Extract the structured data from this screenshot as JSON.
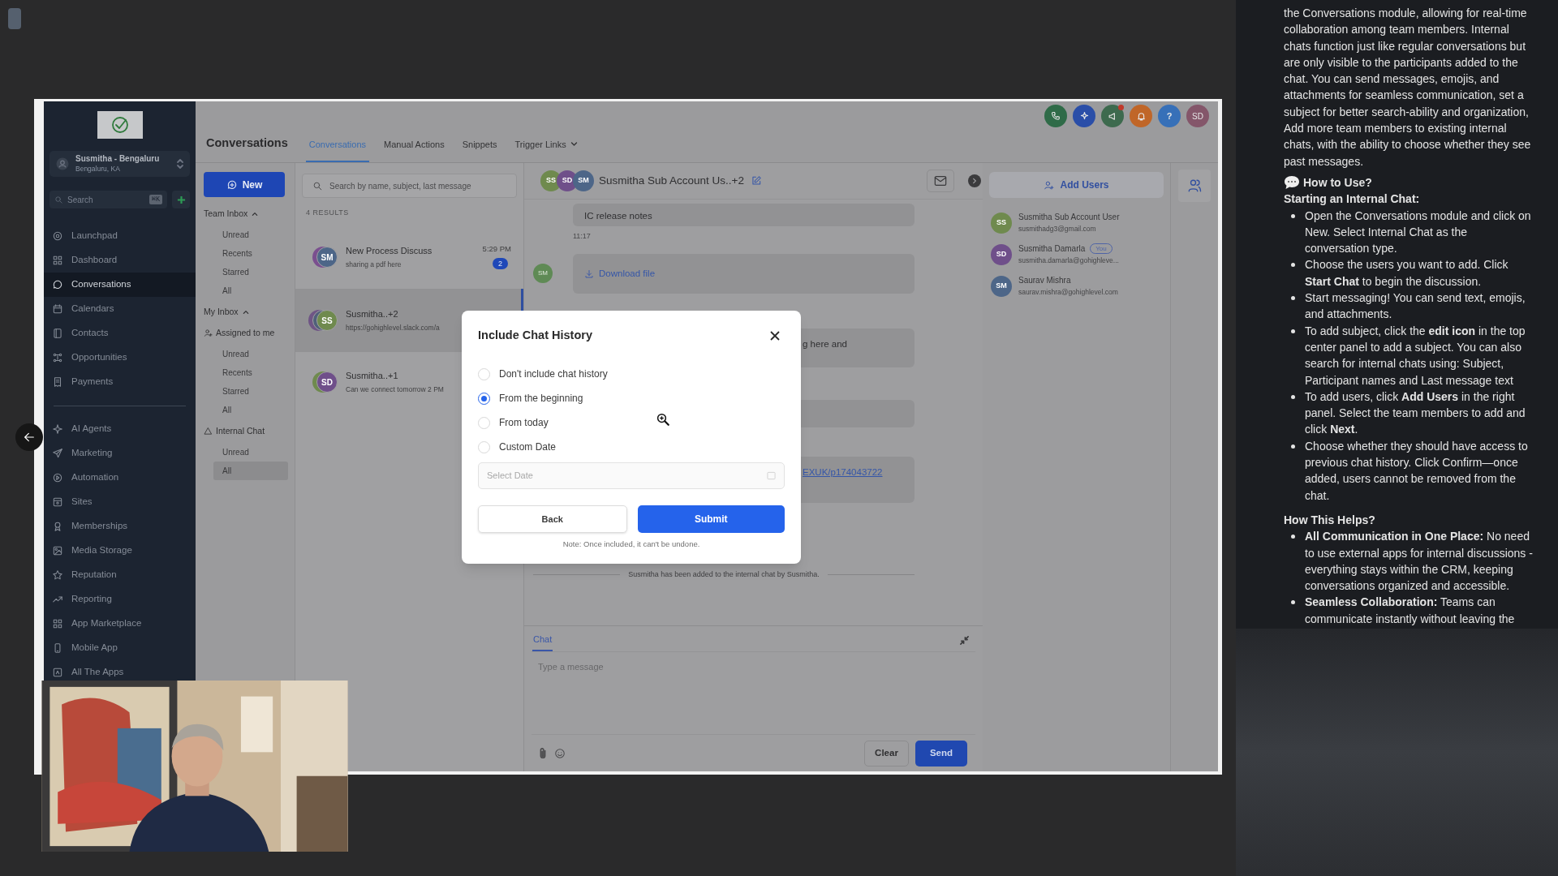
{
  "sidebar": {
    "account": {
      "name": "Susmitha - Bengaluru",
      "location": "Bengaluru, KA"
    },
    "search": {
      "placeholder": "Search",
      "shortcut": "⌘K"
    },
    "primary_items": [
      {
        "label": "Launchpad",
        "selected": false
      },
      {
        "label": "Dashboard",
        "selected": false
      },
      {
        "label": "Conversations",
        "selected": true
      },
      {
        "label": "Calendars",
        "selected": false
      },
      {
        "label": "Contacts",
        "selected": false
      },
      {
        "label": "Opportunities",
        "selected": false
      },
      {
        "label": "Payments",
        "selected": false
      }
    ],
    "secondary_items": [
      {
        "label": "AI Agents",
        "selected": false
      },
      {
        "label": "Marketing",
        "selected": false
      },
      {
        "label": "Automation",
        "selected": false
      },
      {
        "label": "Sites",
        "selected": false
      },
      {
        "label": "Memberships",
        "selected": false
      },
      {
        "label": "Media Storage",
        "selected": false
      },
      {
        "label": "Reputation",
        "selected": false
      },
      {
        "label": "Reporting",
        "selected": false
      },
      {
        "label": "App Marketplace",
        "selected": false
      },
      {
        "label": "Mobile App",
        "selected": false
      },
      {
        "label": "All The Apps",
        "selected": false
      }
    ]
  },
  "header": {
    "title": "Conversations",
    "tabs": [
      {
        "label": "Conversations",
        "selected": true
      },
      {
        "label": "Manual Actions",
        "selected": false
      },
      {
        "label": "Snippets",
        "selected": false
      },
      {
        "label": "Trigger Links",
        "selected": false,
        "dropdown": true
      }
    ],
    "help": "?",
    "user_initials": "SD"
  },
  "inbox_nav": {
    "new_button": "New",
    "sections": [
      {
        "label": "Team Inbox",
        "kind": "group",
        "expanded": true,
        "children": [
          {
            "label": "Unread",
            "selected": false
          },
          {
            "label": "Recents",
            "selected": false
          },
          {
            "label": "Starred",
            "selected": false
          },
          {
            "label": "All",
            "selected": false
          }
        ]
      },
      {
        "label": "My Inbox",
        "kind": "group",
        "expanded": true
      },
      {
        "label": "Assigned to me",
        "kind": "folder",
        "children": [
          {
            "label": "Unread",
            "selected": false
          },
          {
            "label": "Recents",
            "selected": false
          },
          {
            "label": "Starred",
            "selected": false
          },
          {
            "label": "All",
            "selected": false
          }
        ]
      },
      {
        "label": "Internal Chat",
        "kind": "folder",
        "children": [
          {
            "label": "Unread",
            "selected": false
          },
          {
            "label": "All",
            "selected": true
          }
        ]
      }
    ]
  },
  "conversation_list": {
    "search_placeholder": "Search by name, subject, last message",
    "result_count": "4 RESULTS",
    "items": [
      {
        "title": "New Process Discuss",
        "preview": "sharing a pdf here",
        "time": "5:29 PM",
        "unread": "2",
        "selected": false,
        "avatars": [
          {
            "color": "#7a4f8f"
          },
          {
            "initials": "SM",
            "color": "#4d6688"
          }
        ]
      },
      {
        "title": "Susmitha..+2",
        "preview": "https://gohighlevel.slack.com/a",
        "selected": true,
        "avatars": [
          {
            "color": "#6f5585"
          },
          {
            "color": "#50607a"
          },
          {
            "initials": "SS",
            "color": "#6f8a4e"
          }
        ]
      },
      {
        "title": "Susmitha..+1",
        "preview": "Can we connect tomorrow 2 PM",
        "selected": false,
        "avatars": [
          {
            "color": "#6f8a4e"
          },
          {
            "initials": "SD",
            "color": "#6f4f8a"
          }
        ]
      }
    ]
  },
  "chat": {
    "title": "Susmitha Sub Account Us..+2",
    "avatars": [
      {
        "initials": "SS",
        "color": "#6f8a4e"
      },
      {
        "initials": "SD",
        "color": "#6f4f8a"
      },
      {
        "initials": "SM",
        "color": "#4d6688"
      }
    ],
    "messages": [
      {
        "kind": "text",
        "text": "IC release notes",
        "time": "11:17"
      },
      {
        "kind": "file",
        "avatar": "SM",
        "text": "Download file"
      },
      {
        "kind": "text",
        "text": "g here and"
      },
      {
        "kind": "blank"
      },
      {
        "kind": "link",
        "text": "EXUK/p174043722"
      }
    ],
    "system_note": "Susmitha has been added to the internal chat by Susmitha.",
    "composer": {
      "tab": "Chat",
      "placeholder": "Type a message",
      "clear": "Clear",
      "send": "Send"
    }
  },
  "participants_panel": {
    "add_users": "Add Users",
    "users": [
      {
        "name": "Susmitha Sub Account User",
        "email": "susmithadg3@gmail.com",
        "initials": "SS",
        "color": "#6f8a4e"
      },
      {
        "name": "Susmitha Damarla",
        "email": "susmitha.damarla@gohighleve...",
        "initials": "SD",
        "color": "#6f4f8a",
        "badge": "You"
      },
      {
        "name": "Saurav Mishra",
        "email": "saurav.mishra@gohighlevel.com",
        "initials": "SM",
        "color": "#4d6688"
      }
    ]
  },
  "dialog": {
    "title": "Include Chat History",
    "options": [
      {
        "label": "Don't include chat history",
        "selected": false
      },
      {
        "label": "From the beginning",
        "selected": true
      },
      {
        "label": "From today",
        "selected": false
      },
      {
        "label": "Custom Date",
        "selected": false
      }
    ],
    "date_placeholder": "Select Date",
    "back": "Back",
    "submit": "Submit",
    "note": "Note: Once included, it can't be undone."
  },
  "notes_panel": {
    "intro": "the Conversations module, allowing for real-time collaboration among team members. Internal chats function just like regular conversations but are only visible to the participants added to the chat. You can send messages, emojis, and attachments for seamless communication, set a subject for better search-ability and organization, Add more team members to existing internal chats, with the ability to choose whether they see past messages.",
    "how_to_use": {
      "heading": "How to Use?",
      "subheading": "Starting an Internal Chat:",
      "bullets": [
        "Open the Conversations module and click on New. Select Internal Chat as the conversation type.",
        "Choose the users you want to add. Click **Start Chat** to begin the discussion.",
        "Start messaging! You can send text, emojis, and attachments.",
        "To add subject, click the **edit icon** in the top center panel to add a subject. You can also search for internal chats using: Subject, Participant names and Last message text",
        "To add users, click **Add Users** in the right panel. Select the team members to add and click **Next**.",
        "Choose whether they should have access to previous chat history. Click Confirm—once added, users cannot be removed from the chat."
      ]
    },
    "how_this_helps": {
      "heading": "How This Helps?",
      "bullets": [
        "**All Communication in One Place:** No need to use external apps for internal discussions - everything stays within the CRM, keeping conversations organized and accessible.",
        "**Seamless Collaboration:** Teams can communicate instantly without leaving the"
      ]
    }
  }
}
